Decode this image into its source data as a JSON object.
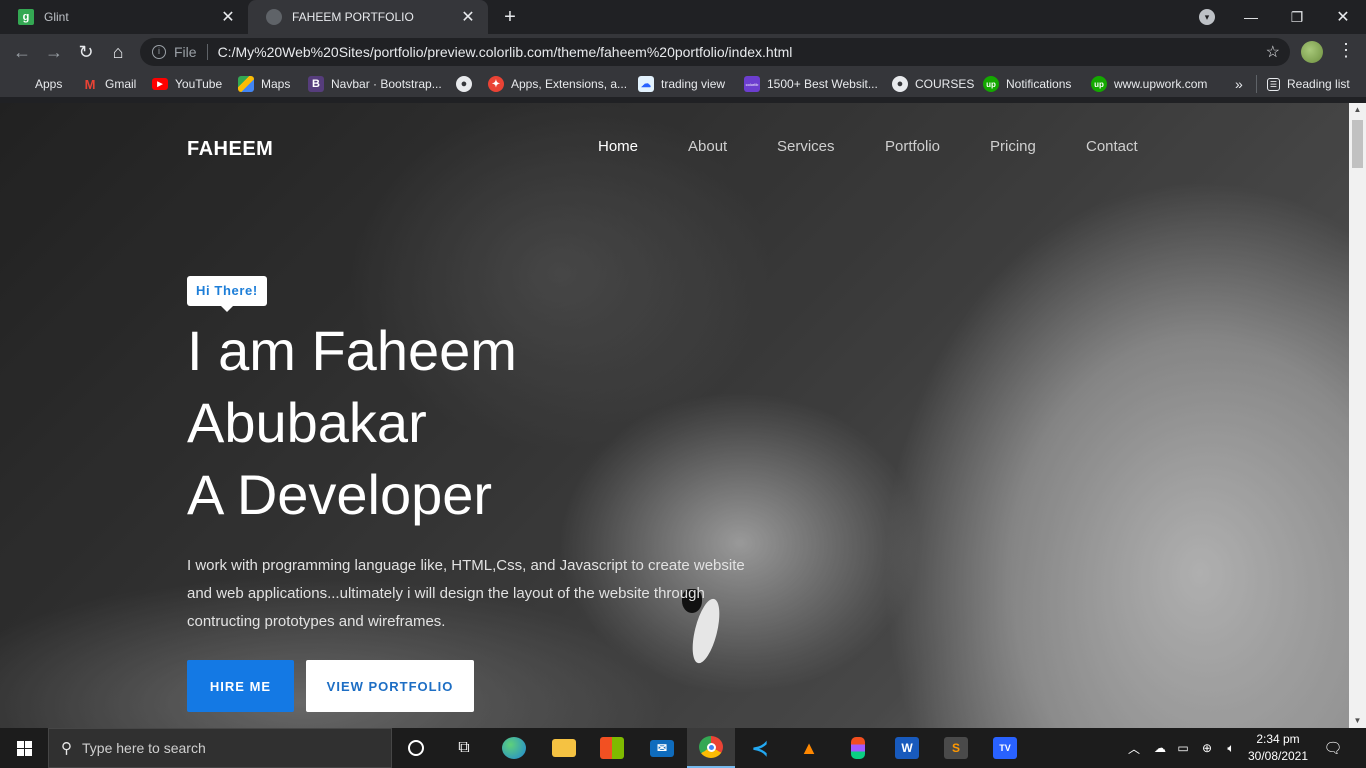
{
  "browser": {
    "tabs": [
      {
        "title": "Glint",
        "favicon": "g"
      },
      {
        "title": "FAHEEM PORTFOLIO",
        "favicon": ""
      }
    ],
    "omnibox": {
      "scheme": "File",
      "url": "C:/My%20Web%20Sites/portfolio/preview.colorlib.com/theme/faheem%20portfolio/index.html"
    },
    "bookmarks": [
      {
        "label": "Apps",
        "icon": "apps-grid-icon"
      },
      {
        "label": "Gmail",
        "icon": "gmail-icon"
      },
      {
        "label": "YouTube",
        "icon": "youtube-icon"
      },
      {
        "label": "Maps",
        "icon": "maps-icon"
      },
      {
        "label": "Navbar · Bootstrap...",
        "icon": "bootstrap-icon",
        "icon_text": "B"
      },
      {
        "label": "",
        "icon": "globe-icon"
      },
      {
        "label": "Apps, Extensions, a...",
        "icon": "extensions-icon"
      },
      {
        "label": "trading view",
        "icon": "tradingview-icon"
      },
      {
        "label": "1500+ Best Websit...",
        "icon": "colorlib-icon",
        "icon_text": "colorlib"
      },
      {
        "label": "COURSES",
        "icon": "globe-icon"
      },
      {
        "label": "Notifications",
        "icon": "upwork-icon",
        "icon_text": "up"
      },
      {
        "label": "www.upwork.com",
        "icon": "upwork-icon",
        "icon_text": "up"
      }
    ],
    "bookmarks_overflow": "»",
    "reading_list": "Reading list"
  },
  "site": {
    "brand": "FAHEEM",
    "nav": [
      "Home",
      "About",
      "Services",
      "Portfolio",
      "Pricing",
      "Contact"
    ],
    "active_nav": "Home",
    "hero": {
      "badge": "Hi There!",
      "headline": [
        "I am Faheem",
        "Abubakar",
        "A Developer"
      ],
      "description": "I work with programming language like, HTML,Css, and Javascript to create website and web applications...ultimately i will design the layout of the website through contructing prototypes and wireframes.",
      "primary_button": "HIRE ME",
      "secondary_button": "VIEW PORTFOLIO"
    }
  },
  "taskbar": {
    "search_placeholder": "Type here to search",
    "time": "2:34 pm",
    "date": "30/08/2021",
    "apps": [
      "task-view",
      "edge",
      "file-explorer",
      "store",
      "mail",
      "chrome",
      "vscode",
      "vlc",
      "figma",
      "word",
      "sublime",
      "tradingview"
    ]
  },
  "colors": {
    "accent_blue": "#1479e4",
    "badge_text": "#1d7ed8",
    "chrome_dark": "#202124",
    "chrome_toolbar": "#35363a"
  }
}
